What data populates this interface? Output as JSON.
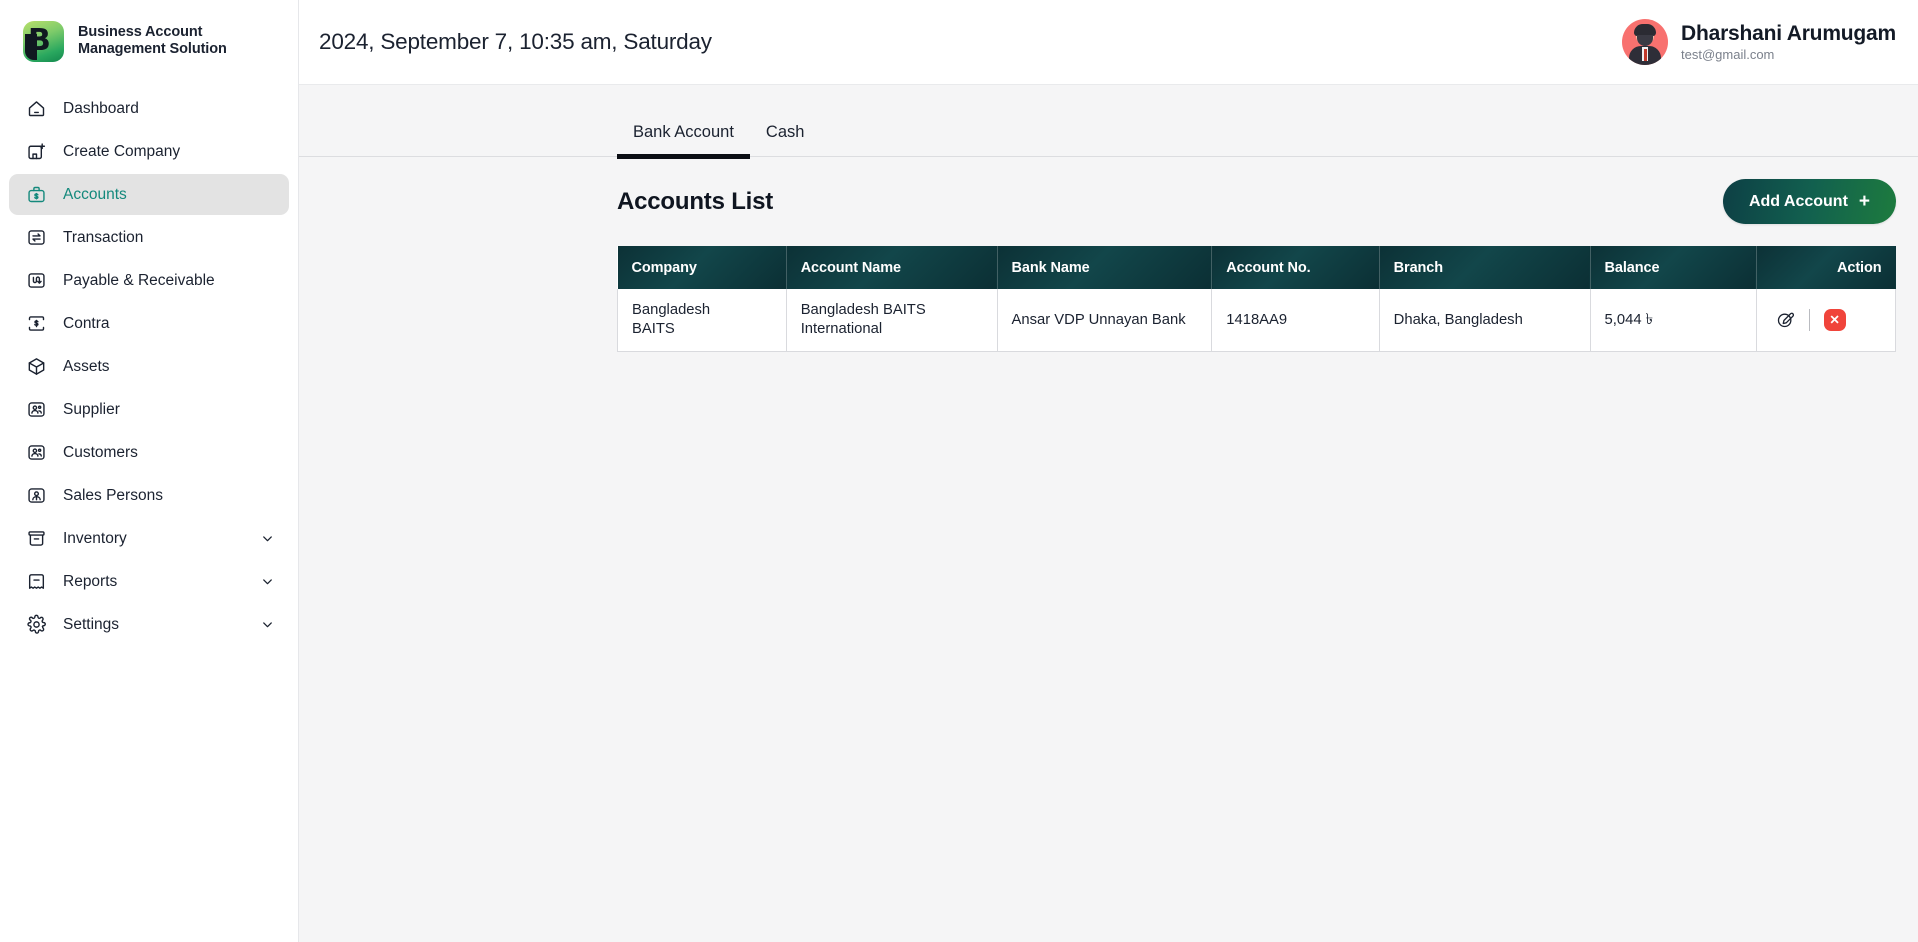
{
  "brand": {
    "name_line1": "Business Account",
    "name_line2": "Management Solution",
    "logo_letter": "B",
    "logo_gradient_from": "#b9e06a",
    "logo_gradient_to": "#13884d"
  },
  "sidebar": {
    "items": [
      {
        "label": "Dashboard",
        "icon": "home-icon",
        "active": false,
        "expandable": false
      },
      {
        "label": "Create Company",
        "icon": "building-plus-icon",
        "active": false,
        "expandable": false
      },
      {
        "label": "Accounts",
        "icon": "briefcase-dollar-icon",
        "active": true,
        "expandable": false
      },
      {
        "label": "Transaction",
        "icon": "transfer-icon",
        "active": false,
        "expandable": false
      },
      {
        "label": "Payable & Receivable",
        "icon": "payable-receivable-icon",
        "active": false,
        "expandable": false
      },
      {
        "label": "Contra",
        "icon": "contra-dollar-icon",
        "active": false,
        "expandable": false
      },
      {
        "label": "Assets",
        "icon": "box-icon",
        "active": false,
        "expandable": false
      },
      {
        "label": "Supplier",
        "icon": "users-icon",
        "active": false,
        "expandable": false
      },
      {
        "label": "Customers",
        "icon": "users-icon",
        "active": false,
        "expandable": false
      },
      {
        "label": "Sales Persons",
        "icon": "user-badge-icon",
        "active": false,
        "expandable": false
      },
      {
        "label": "Inventory",
        "icon": "archive-icon",
        "active": false,
        "expandable": true
      },
      {
        "label": "Reports",
        "icon": "report-icon",
        "active": false,
        "expandable": true
      },
      {
        "label": "Settings",
        "icon": "gear-icon",
        "active": false,
        "expandable": true
      }
    ],
    "active_color": "#14897c",
    "active_background": "#e3e3e3"
  },
  "topbar": {
    "datetime": "2024, September 7, 10:35 am, Saturday",
    "user": {
      "name": "Dharshani Arumugam",
      "email": "test@gmail.com",
      "avatar_background": "#f8716f"
    }
  },
  "tabs": [
    {
      "label": "Bank Account",
      "active": true
    },
    {
      "label": "Cash",
      "active": false
    }
  ],
  "section": {
    "title": "Accounts List",
    "add_button": {
      "label": "Add Account",
      "plus_glyph": "+"
    }
  },
  "table": {
    "columns": [
      "Company",
      "Account Name",
      "Bank Name",
      "Account No.",
      "Branch",
      "Balance",
      "Action"
    ],
    "rows": [
      {
        "company": "Bangladesh\nBAITS",
        "account_name": "Bangladesh BAITS\nInternational",
        "bank_name": "Ansar VDP Unnayan Bank",
        "account_no": "1418AA9",
        "branch": "Dhaka, Bangladesh",
        "balance": "5,044 ৳",
        "actions": {
          "edit_label": "",
          "delete_glyph": "✕"
        }
      }
    ]
  },
  "colors": {
    "table_header_dark": "#0c3136",
    "table_header_teal": "#12464a",
    "delete_red": "#f0443b",
    "page_background": "#f5f5f6"
  }
}
